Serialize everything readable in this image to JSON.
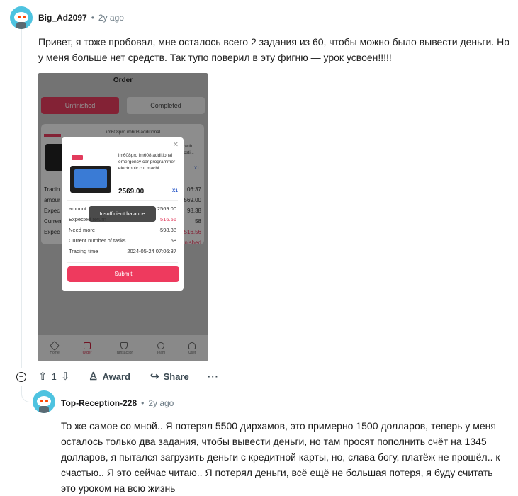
{
  "comment1": {
    "username": "Big_Ad2097",
    "separator": "•",
    "age": "2y ago",
    "text": "Привет, я тоже пробовал, мне осталось всего 2 задания из 60, чтобы можно было вывести деньги. Но у меня больше нет средств. Так тупо поверил в эту фигню — урок усвоен!!!!!",
    "screenshot": {
      "header": "Order",
      "tab_unfinished": "Unfinished",
      "tab_completed": "Completed",
      "bg_title": "im608pro im608 additional",
      "bg_desc": "s with\nnosti...",
      "bg_qty": "X1",
      "bg_rows": [
        {
          "label": "Tradin",
          "value": "06:37"
        },
        {
          "label": "amour",
          "value": "569.00"
        },
        {
          "label": "Expec",
          "value": "98.38"
        },
        {
          "label": "Curren",
          "value": "58"
        },
        {
          "label": "Expec",
          "value": "516.56"
        }
      ],
      "bg_status": "nished",
      "modal": {
        "product_title": "im608pro im608 additional emergency car programmer electronic cut machi...",
        "price": "2569.00",
        "qty": "X1",
        "rows": [
          {
            "label": "amount",
            "value": "2569.00"
          },
          {
            "label": "Expected return",
            "value": "516.56"
          },
          {
            "label": "Need more",
            "value": "-598.38"
          },
          {
            "label": "Current number of tasks",
            "value": "58"
          },
          {
            "label": "Trading time",
            "value": "2024-05-24 07:06:37"
          }
        ],
        "tooltip": "Insufficient balance",
        "submit_label": "Submit"
      },
      "nav": [
        "Home",
        "Order",
        "Transaction",
        "Team",
        "User"
      ]
    },
    "actions": {
      "votes": "1",
      "award_label": "Award",
      "share_label": "Share",
      "more_label": "···"
    }
  },
  "comment2": {
    "username": "Top-Reception-228",
    "separator": "•",
    "age": "2y ago",
    "text": "То же самое со мной.. Я потерял 5500 дирхамов, это примерно 1500 долларов, теперь у меня осталось только два задания, чтобы вывести деньги, но там просят пополнить счёт на 1345 долларов, я пытался загрузить деньги с кредитной карты, но, слава богу, платёж не прошёл.. к счастью.. Я это сейчас читаю.. Я потерял деньги, всё ещё не большая потеря, я буду считать это уроком на всю жизнь"
  },
  "colors": {
    "avatar": "#4ec3e0",
    "accent_red": "#e23b5c",
    "text_meta": "#6b7a84"
  }
}
